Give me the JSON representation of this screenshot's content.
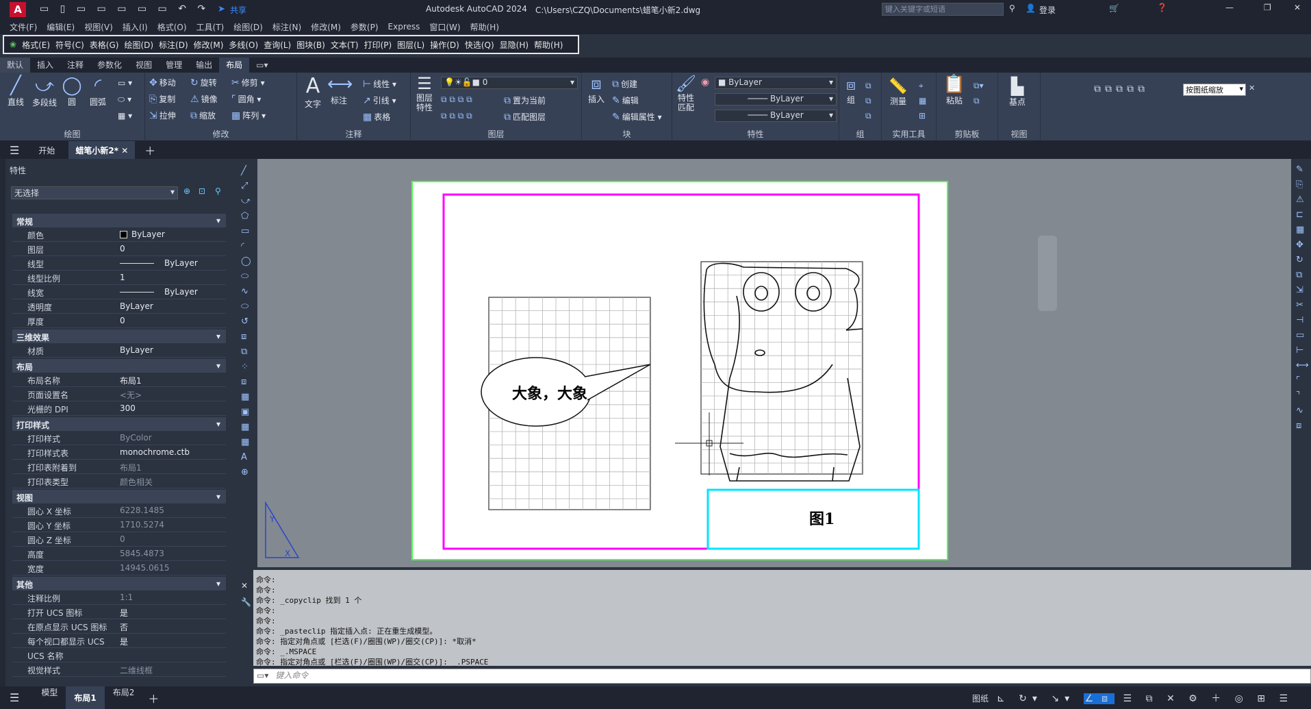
{
  "title": {
    "app": "Autodesk AutoCAD 2024",
    "path": "C:\\Users\\CZQ\\Documents\\蜡笔小新2.dwg",
    "share": "共享",
    "search_placeholder": "键入关键字或短语",
    "login": "登录"
  },
  "menu": [
    "文件(F)",
    "编辑(E)",
    "视图(V)",
    "插入(I)",
    "格式(O)",
    "工具(T)",
    "绘图(D)",
    "标注(N)",
    "修改(M)",
    "参数(P)",
    "Express",
    "窗口(W)",
    "帮助(H)"
  ],
  "legacymenu": [
    "格式(E)",
    "符号(C)",
    "表格(G)",
    "绘图(D)",
    "标注(D)",
    "修改(M)",
    "多线(O)",
    "查询(L)",
    "图块(B)",
    "文本(T)",
    "打印(P)",
    "图层(L)",
    "操作(D)",
    "快选(Q)",
    "显隐(H)",
    "帮助(H)"
  ],
  "ribbon_tabs": [
    "默认",
    "插入",
    "注释",
    "参数化",
    "视图",
    "管理",
    "输出",
    "布局"
  ],
  "ribbon": {
    "draw": {
      "label": "绘图",
      "line": "直线",
      "pline": "多段线",
      "circle": "圆",
      "arc": "圆弧"
    },
    "modify": {
      "label": "修改",
      "move": "移动",
      "rotate": "旋转",
      "trim": "修剪",
      "copy": "复制",
      "mirror": "镜像",
      "fillet": "圆角",
      "stretch": "拉伸",
      "scale": "缩放",
      "array": "阵列"
    },
    "annot": {
      "label": "注释",
      "text": "文字",
      "dim": "标注",
      "linear": "线性",
      "leader": "引线",
      "table": "表格"
    },
    "layers": {
      "label": "图层",
      "props": "图层\n特性",
      "layer_value": "0",
      "setcurrent": "置为当前",
      "match": "匹配图层"
    },
    "block": {
      "label": "块",
      "insert": "插入",
      "create": "创建",
      "edit": "编辑",
      "editattr": "编辑属性"
    },
    "props": {
      "label": "特性",
      "match": "特性\n匹配",
      "color": "ByLayer",
      "linetype": "ByLayer",
      "lineweight": "ByLayer"
    },
    "groups": {
      "label": "组",
      "group": "组"
    },
    "utils": {
      "label": "实用工具",
      "measure": "测量"
    },
    "clip": {
      "label": "剪贴板",
      "paste": "粘贴"
    },
    "view": {
      "label": "视图",
      "base": "基点"
    },
    "zoom_select": "按图纸缩放"
  },
  "doctabs": {
    "start": "开始",
    "doc": "蜡笔小新2*"
  },
  "palette": {
    "title": "特性",
    "selection": "无选择",
    "sections": [
      {
        "name": "常规",
        "rows": [
          [
            "颜色",
            "ByLayer"
          ],
          [
            "图层",
            "0"
          ],
          [
            "线型",
            "ByLayer"
          ],
          [
            "线型比例",
            "1"
          ],
          [
            "线宽",
            "ByLayer"
          ],
          [
            "透明度",
            "ByLayer"
          ],
          [
            "厚度",
            "0"
          ]
        ]
      },
      {
        "name": "三维效果",
        "rows": [
          [
            "材质",
            "ByLayer"
          ]
        ]
      },
      {
        "name": "布局",
        "rows": [
          [
            "布局名称",
            "布局1"
          ],
          [
            "页面设置名",
            "<无>"
          ],
          [
            "光栅的 DPI",
            "300"
          ]
        ]
      },
      {
        "name": "打印样式",
        "rows": [
          [
            "打印样式",
            "ByColor"
          ],
          [
            "打印样式表",
            "monochrome.ctb"
          ],
          [
            "打印表附着到",
            "布局1"
          ],
          [
            "打印表类型",
            "颜色相关"
          ]
        ]
      },
      {
        "name": "视图",
        "rows": [
          [
            "圆心 X 坐标",
            "6228.1485"
          ],
          [
            "圆心 Y 坐标",
            "1710.5274"
          ],
          [
            "圆心 Z 坐标",
            "0"
          ],
          [
            "高度",
            "5845.4873"
          ],
          [
            "宽度",
            "14945.0615"
          ]
        ]
      },
      {
        "name": "其他",
        "rows": [
          [
            "注释比例",
            "1:1"
          ],
          [
            "打开 UCS 图标",
            "是"
          ],
          [
            "在原点显示 UCS 图标",
            "否"
          ],
          [
            "每个视口都显示 UCS",
            "是"
          ],
          [
            "UCS 名称",
            ""
          ],
          [
            "视觉样式",
            "二维线框"
          ]
        ]
      }
    ]
  },
  "drawing": {
    "bubble_text": "大象，大象",
    "caption": "图1"
  },
  "command_lines": [
    "命令:",
    "命令:",
    "命令: _copyclip 找到 1 个",
    "命令:",
    "命令:",
    "命令: _pasteclip 指定插入点: 正在重生成模型。",
    "命令: 指定对角点或 [栏选(F)/圈围(WP)/圈交(CP)]: *取消*",
    "命令: _.MSPACE",
    "命令: 指定对角点或 [栏选(F)/圈围(WP)/圈交(CP)]: _.PSPACE"
  ],
  "command_placeholder": "键入命令",
  "status": {
    "tabs": [
      "模型",
      "布局1",
      "布局2"
    ],
    "paper": "图纸"
  },
  "colors": {
    "magenta": "#ff00ff",
    "cyan": "#00e5ff",
    "green": "#4cff4c",
    "accent": "#1a6fd6"
  }
}
